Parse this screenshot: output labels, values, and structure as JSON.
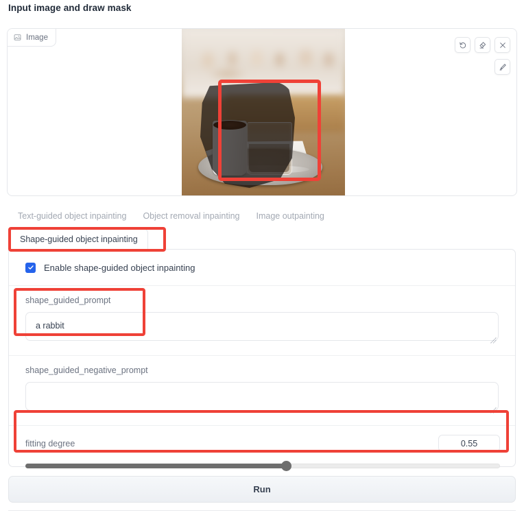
{
  "page": {
    "title": "Input image and draw mask"
  },
  "image_panel": {
    "tag_label": "Image",
    "tag_icon": "image-icon",
    "tools": [
      {
        "name": "undo-icon",
        "title": "Undo"
      },
      {
        "name": "eraser-icon",
        "title": "Erase"
      },
      {
        "name": "close-icon",
        "title": "Clear"
      }
    ],
    "brush_tool": {
      "name": "brush-icon",
      "title": "Brush"
    }
  },
  "tabs": {
    "items": [
      {
        "label": "Text-guided object inpainting",
        "selected": false
      },
      {
        "label": "Object removal inpainting",
        "selected": false
      },
      {
        "label": "Image outpainting",
        "selected": false
      }
    ],
    "selected": {
      "label": "Shape-guided object inpainting",
      "selected": true
    }
  },
  "settings": {
    "enable_checkbox": {
      "label": "Enable shape-guided object inpainting",
      "checked": true,
      "check_color": "#2563eb"
    },
    "prompt": {
      "label": "shape_guided_prompt",
      "value": "a rabbit",
      "placeholder": ""
    },
    "negative_prompt": {
      "label": "shape_guided_negative_prompt",
      "value": "",
      "placeholder": ""
    },
    "fitting_degree": {
      "label": "fitting degree",
      "value": "0.55",
      "percent": 55,
      "min": 0,
      "max": 1
    }
  },
  "actions": {
    "run_label": "Run"
  },
  "annotations": {
    "color": "#ef4137",
    "boxes": [
      {
        "name": "mask-region-highlight"
      },
      {
        "name": "selected-tab-highlight"
      },
      {
        "name": "prompt-field-highlight"
      },
      {
        "name": "fitting-degree-highlight"
      }
    ]
  }
}
